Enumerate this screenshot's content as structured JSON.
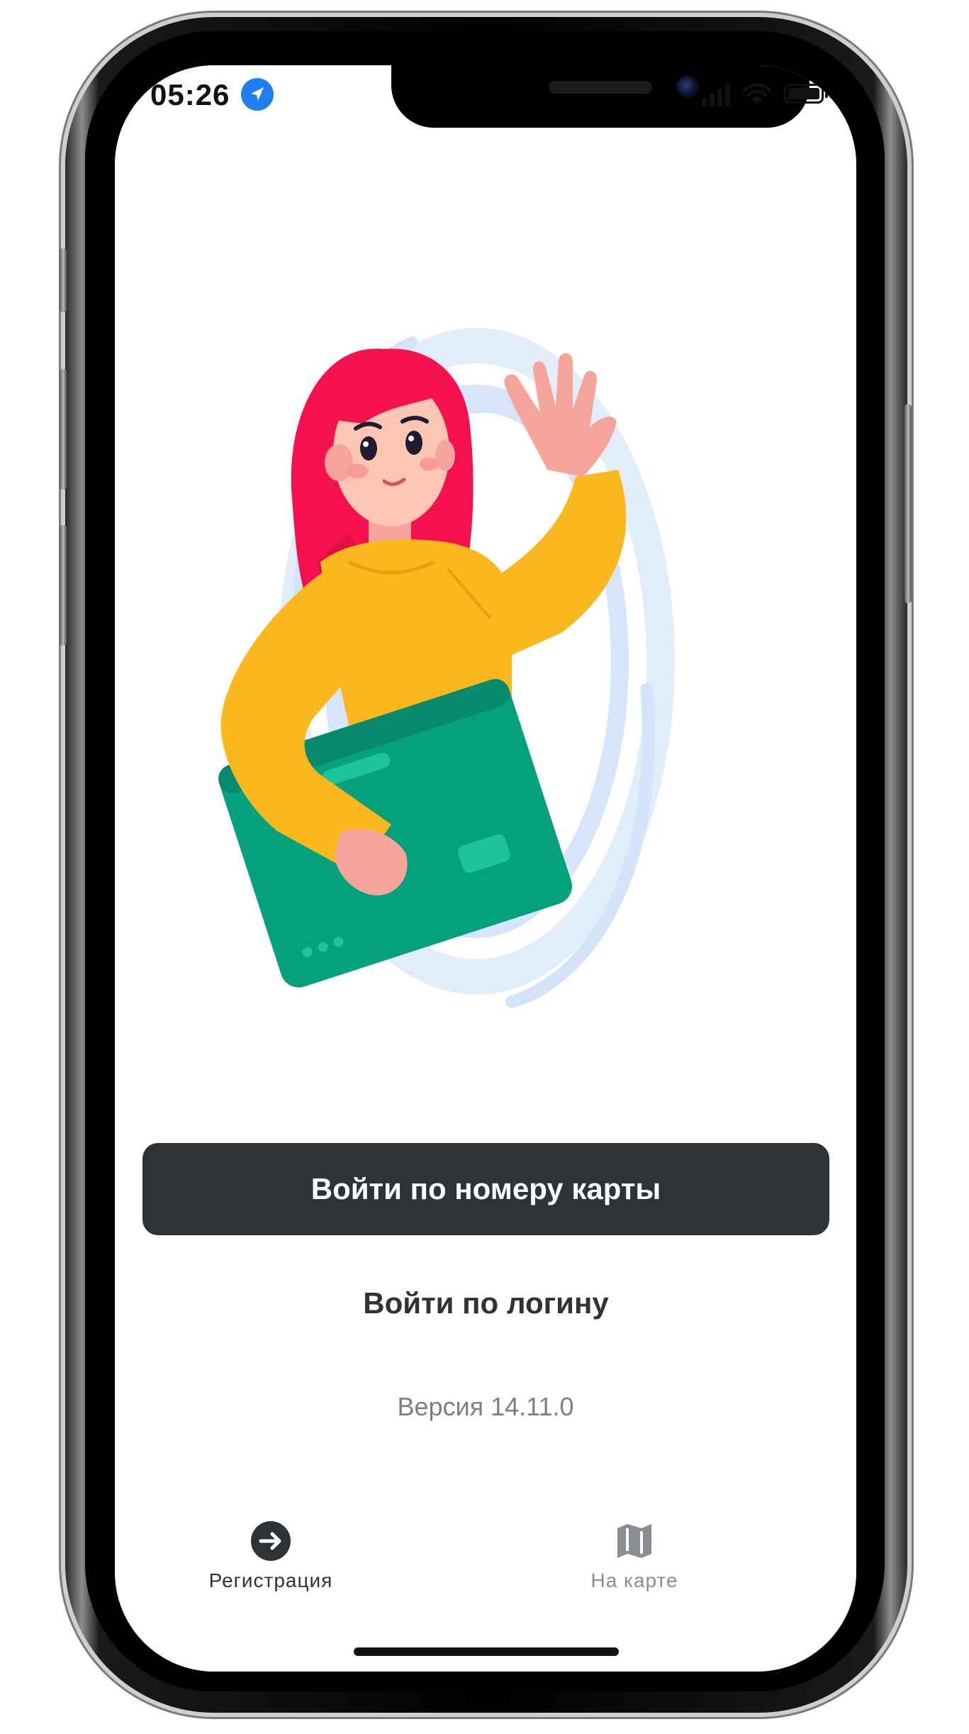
{
  "status_bar": {
    "time": "05:26",
    "location_icon": "location-arrow-icon",
    "signal_icon": "cellular-signal-icon",
    "wifi_icon": "wifi-icon",
    "battery_icon": "battery-icon"
  },
  "hero": {
    "illustration": "woman-waving-holding-card"
  },
  "actions": {
    "card_login_label": "Войти по номеру карты",
    "login_label": "Войти по логину"
  },
  "version_text": "Версия 14.11.0",
  "tabbar": {
    "items": [
      {
        "label": "Регистрация",
        "icon": "arrow-right-circle-icon",
        "color": "#2e3338"
      },
      {
        "label": "На карте",
        "icon": "map-icon",
        "color": "#8a8e92"
      }
    ]
  },
  "colors": {
    "primary_button": "#2e3338",
    "location_badge": "#1f7ef0",
    "hair": "#f5114d",
    "sweater": "#fbb81e",
    "card": "#05a07c",
    "portal": "#dbe8fb"
  }
}
